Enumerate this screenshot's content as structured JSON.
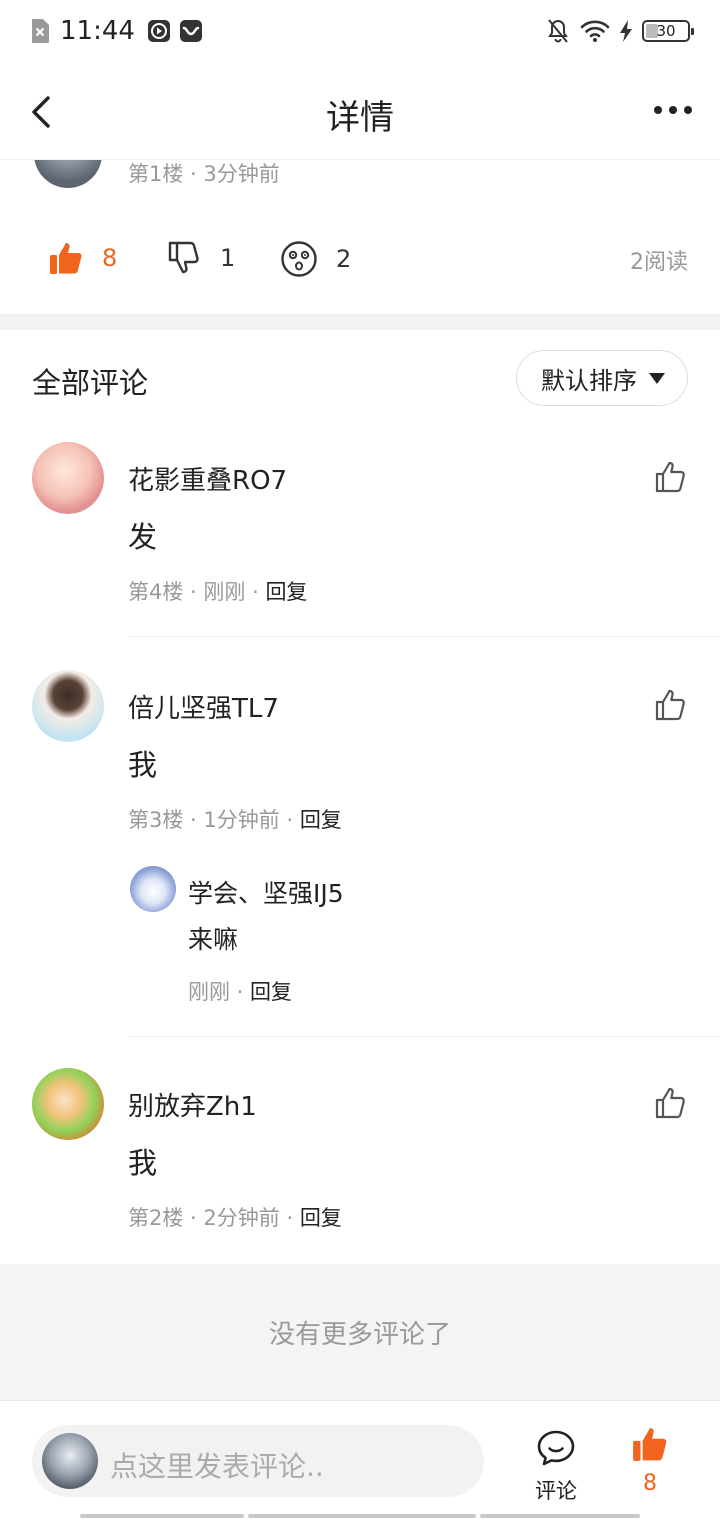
{
  "status_bar": {
    "time": "11:44",
    "battery": "30"
  },
  "header": {
    "title": "详情"
  },
  "post": {
    "floor_meta": "第1楼 · 3分钟前",
    "likes": "8",
    "dislikes": "1",
    "wows": "2",
    "read_count": "2阅读"
  },
  "comments_section": {
    "title": "全部评论",
    "sort_label": "默认排序"
  },
  "comments": [
    {
      "name": "花影重叠RO7",
      "text": "发",
      "floor": "第4楼",
      "time": "刚刚",
      "reply_label": "回复"
    },
    {
      "name": "倍儿坚强TL7",
      "text": "我",
      "floor": "第3楼",
      "time": "1分钟前",
      "reply_label": "回复",
      "sub_reply": {
        "name": "学会、坚强IJ5",
        "text": "来嘛",
        "time": "刚刚",
        "reply_label": "回复"
      }
    },
    {
      "name": "别放弃Zh1",
      "text": "我",
      "floor": "第2楼",
      "time": "2分钟前",
      "reply_label": "回复"
    }
  ],
  "end_message": "没有更多评论了",
  "bottom_bar": {
    "input_placeholder": "点这里发表评论..",
    "comment_label": "评论",
    "like_count": "8"
  },
  "colors": {
    "accent": "#f0641e",
    "muted_text": "#999999",
    "band_bg": "#f4f4f4"
  }
}
